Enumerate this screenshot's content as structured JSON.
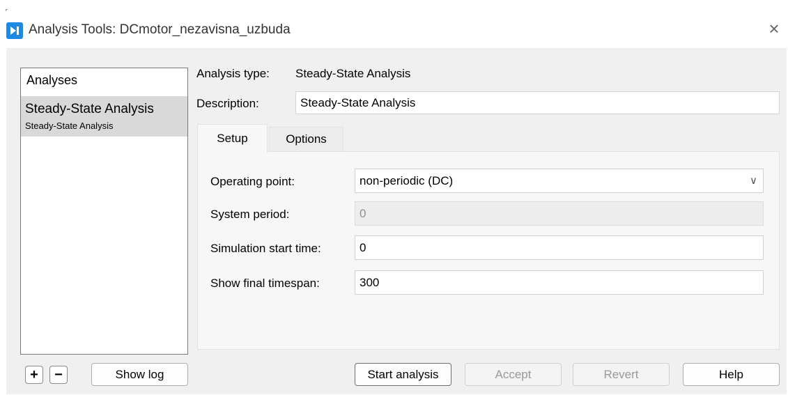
{
  "window": {
    "title": "Analysis Tools: DCmotor_nezavisna_uzbuda"
  },
  "analyses": {
    "header": "Analyses",
    "items": [
      {
        "title": "Steady-State Analysis",
        "subtitle": "Steady-State Analysis"
      }
    ]
  },
  "details": {
    "analysis_type_label": "Analysis type:",
    "analysis_type_value": "Steady-State Analysis",
    "description_label": "Description:",
    "description_value": "Steady-State Analysis"
  },
  "tabs": [
    {
      "label": "Setup",
      "active": true
    },
    {
      "label": "Options",
      "active": false
    }
  ],
  "setup": {
    "operating_point_label": "Operating point:",
    "operating_point_value": "non-periodic (DC)",
    "system_period_label": "System period:",
    "system_period_value": "0",
    "sim_start_label": "Simulation start time:",
    "sim_start_value": "0",
    "final_timespan_label": "Show final timespan:",
    "final_timespan_value": "300"
  },
  "buttons": {
    "add": "+",
    "remove": "−",
    "show_log": "Show log",
    "start_analysis": "Start analysis",
    "accept": "Accept",
    "revert": "Revert",
    "help": "Help"
  },
  "colors": {
    "accent": "#1e88e5",
    "dialog_bg": "#f0f0f0",
    "selected_item": "#d9d9d9"
  },
  "icons": {
    "app": "play-step-icon",
    "close": "close-icon",
    "dropdown": "chevron-down-icon"
  }
}
